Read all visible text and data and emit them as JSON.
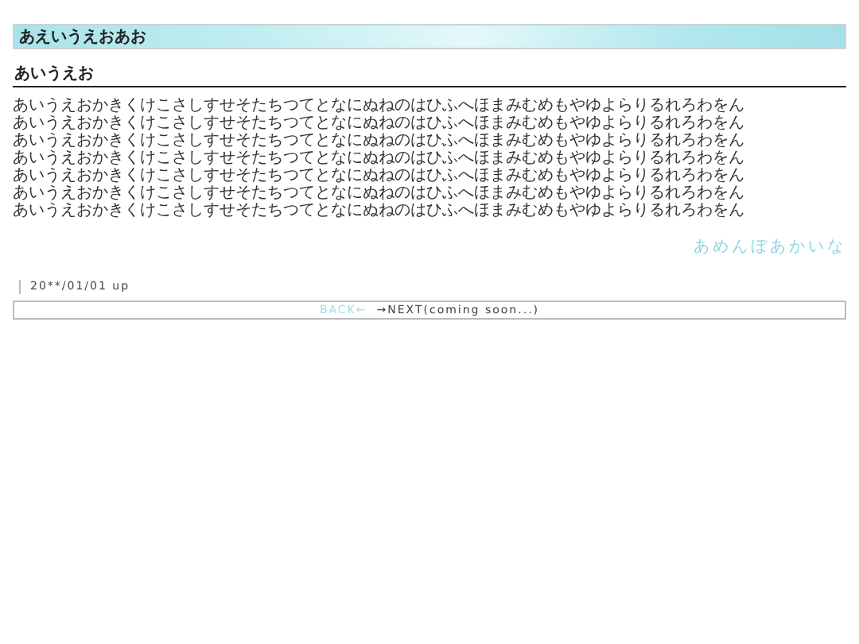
{
  "header": {
    "title": "あえいうえおあお"
  },
  "section": {
    "heading": "あいうえお",
    "lines": [
      "あいうえおかきくけこさしすせそたちつてとなにぬねのはひふへほまみむめもやゆよらりるれろわをん",
      "あいうえおかきくけこさしすせそたちつてとなにぬねのはひふへほまみむめもやゆよらりるれろわをん",
      "あいうえおかきくけこさしすせそたちつてとなにぬねのはひふへほまみむめもやゆよらりるれろわをん",
      "あいうえおかきくけこさしすせそたちつてとなにぬねのはひふへほまみむめもやゆよらりるれろわをん",
      "あいうえおかきくけこさしすせそたちつてとなにぬねのはひふへほまみむめもやゆよらりるれろわをん",
      "あいうえおかきくけこさしすせそたちつてとなにぬねのはひふへほまみむめもやゆよらりるれろわをん",
      "あいうえおかきくけこさしすせそたちつてとなにぬねのはひふへほまみむめもやゆよらりるれろわをん"
    ],
    "signature": "あめんぼあかいな",
    "date": "20**/01/01 up"
  },
  "nav": {
    "back": "BACK←",
    "next": "→NEXT(coming soon...)"
  }
}
